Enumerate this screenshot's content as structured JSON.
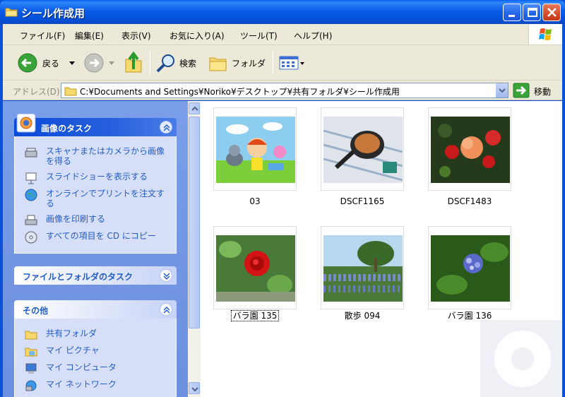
{
  "window": {
    "title": "シール作成用"
  },
  "menu": {
    "items": [
      "ファイル(F)",
      "編集(E)",
      "表示(V)",
      "お気に入り(A)",
      "ツール(T)",
      "ヘルプ(H)"
    ]
  },
  "toolbar": {
    "back_label": "戻る",
    "search_label": "検索",
    "folders_label": "フォルダ"
  },
  "address": {
    "label": "アドレス(D)",
    "path": "C:¥Documents and Settings¥Noriko¥デスクトップ¥共有フォルダ¥シール作成用",
    "go_label": "移動"
  },
  "taskpane": {
    "image_tasks": {
      "title": "画像のタスク",
      "items": [
        "スキャナまたはカメラから画像を得る",
        "スライドショーを表示する",
        "オンラインでプリントを注文する",
        "画像を印刷する",
        "すべての項目を CD にコピー"
      ]
    },
    "file_tasks": {
      "title": "ファイルとフォルダのタスク"
    },
    "other": {
      "title": "その他",
      "items": [
        "共有フォルダ",
        "マイ ピクチャ",
        "マイ コンピュータ",
        "マイ ネットワーク"
      ]
    }
  },
  "files": [
    {
      "name": "03",
      "selected": false
    },
    {
      "name": "DSCF1165",
      "selected": false
    },
    {
      "name": "DSCF1483",
      "selected": false
    },
    {
      "name": "バラ園 135",
      "selected": true
    },
    {
      "name": "散歩 094",
      "selected": false
    },
    {
      "name": "バラ園 136",
      "selected": false
    }
  ],
  "colors": {
    "titlebar": "#0a5ef0",
    "taskpane_bg": "#7a9ee8",
    "task_link": "#215dc6",
    "chrome_bg": "#ece9d8"
  }
}
